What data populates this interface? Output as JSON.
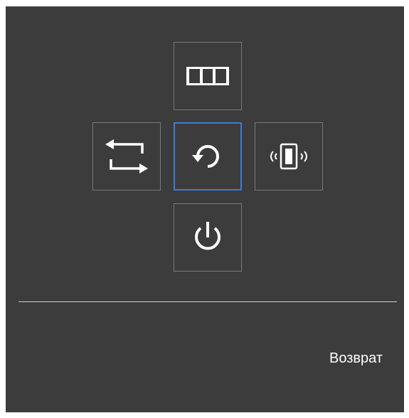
{
  "menu": {
    "items": [
      {
        "id": "up",
        "icon": "columns-icon"
      },
      {
        "id": "left",
        "icon": "swap-arrows-icon"
      },
      {
        "id": "center",
        "icon": "return-arrow-icon",
        "selected": true
      },
      {
        "id": "right",
        "icon": "vibrating-phone-icon"
      },
      {
        "id": "down",
        "icon": "power-icon"
      }
    ],
    "status_label": "Возврат"
  },
  "colors": {
    "panel_bg": "#3c3c3c",
    "border": "#7a7a7a",
    "selected_border": "#3e7bd6",
    "text": "#ffffff",
    "divider": "#cfcfcf"
  }
}
